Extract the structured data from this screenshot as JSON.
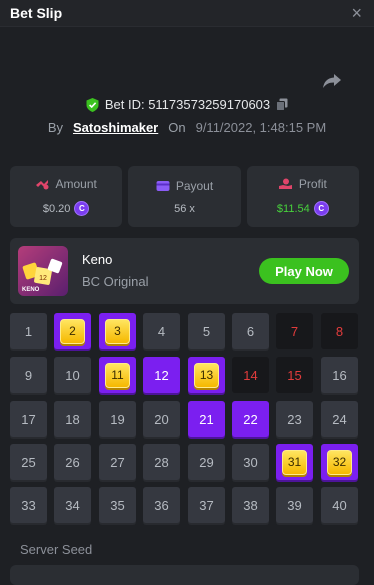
{
  "header": {
    "title": "Bet Slip",
    "close_icon": "×"
  },
  "bet": {
    "id_text": "Bet ID: 5117357325917060​3",
    "by_label": "By",
    "username": "Satoshimaker",
    "on_label": "On",
    "date": "9/11/2022, 1:48:15 PM"
  },
  "stats": {
    "amount": {
      "label": "Amount",
      "value": "$0.20"
    },
    "payout": {
      "label": "Payout",
      "value": "56 x"
    },
    "profit": {
      "label": "Profit",
      "value": "$11.54"
    }
  },
  "game": {
    "name": "Keno",
    "subtitle": "BC Original",
    "play_label": "Play Now",
    "thumb_text": "KENO"
  },
  "board": {
    "cells": [
      {
        "n": "1",
        "s": "normal"
      },
      {
        "n": "2",
        "s": "hit"
      },
      {
        "n": "3",
        "s": "hit"
      },
      {
        "n": "4",
        "s": "normal"
      },
      {
        "n": "5",
        "s": "normal"
      },
      {
        "n": "6",
        "s": "normal"
      },
      {
        "n": "7",
        "s": "miss"
      },
      {
        "n": "8",
        "s": "miss"
      },
      {
        "n": "9",
        "s": "normal"
      },
      {
        "n": "10",
        "s": "normal"
      },
      {
        "n": "11",
        "s": "hit"
      },
      {
        "n": "12",
        "s": "selected"
      },
      {
        "n": "13",
        "s": "hit"
      },
      {
        "n": "14",
        "s": "miss"
      },
      {
        "n": "15",
        "s": "miss"
      },
      {
        "n": "16",
        "s": "normal"
      },
      {
        "n": "17",
        "s": "normal"
      },
      {
        "n": "18",
        "s": "normal"
      },
      {
        "n": "19",
        "s": "normal"
      },
      {
        "n": "20",
        "s": "normal"
      },
      {
        "n": "21",
        "s": "selected"
      },
      {
        "n": "22",
        "s": "selected"
      },
      {
        "n": "23",
        "s": "normal"
      },
      {
        "n": "24",
        "s": "normal"
      },
      {
        "n": "25",
        "s": "normal"
      },
      {
        "n": "26",
        "s": "normal"
      },
      {
        "n": "27",
        "s": "normal"
      },
      {
        "n": "28",
        "s": "normal"
      },
      {
        "n": "29",
        "s": "normal"
      },
      {
        "n": "30",
        "s": "normal"
      },
      {
        "n": "31",
        "s": "hit"
      },
      {
        "n": "32",
        "s": "hit"
      },
      {
        "n": "33",
        "s": "normal"
      },
      {
        "n": "34",
        "s": "normal"
      },
      {
        "n": "35",
        "s": "normal"
      },
      {
        "n": "36",
        "s": "normal"
      },
      {
        "n": "37",
        "s": "normal"
      },
      {
        "n": "38",
        "s": "normal"
      },
      {
        "n": "39",
        "s": "normal"
      },
      {
        "n": "40",
        "s": "normal"
      }
    ]
  },
  "seed": {
    "label": "Server Seed"
  },
  "colors": {
    "accent": "#7b1ff0",
    "gold": "#f5c400",
    "play": "#3bc11f",
    "miss_text": "#e23c3c",
    "profit": "#47d13c"
  },
  "icons": {
    "share": "share-icon",
    "verified": "shield-check-icon",
    "copy": "copy-icon",
    "amount": "coins-icon",
    "payout": "wallet-icon",
    "profit": "hand-coin-icon",
    "coin": "bc-coin-icon"
  }
}
